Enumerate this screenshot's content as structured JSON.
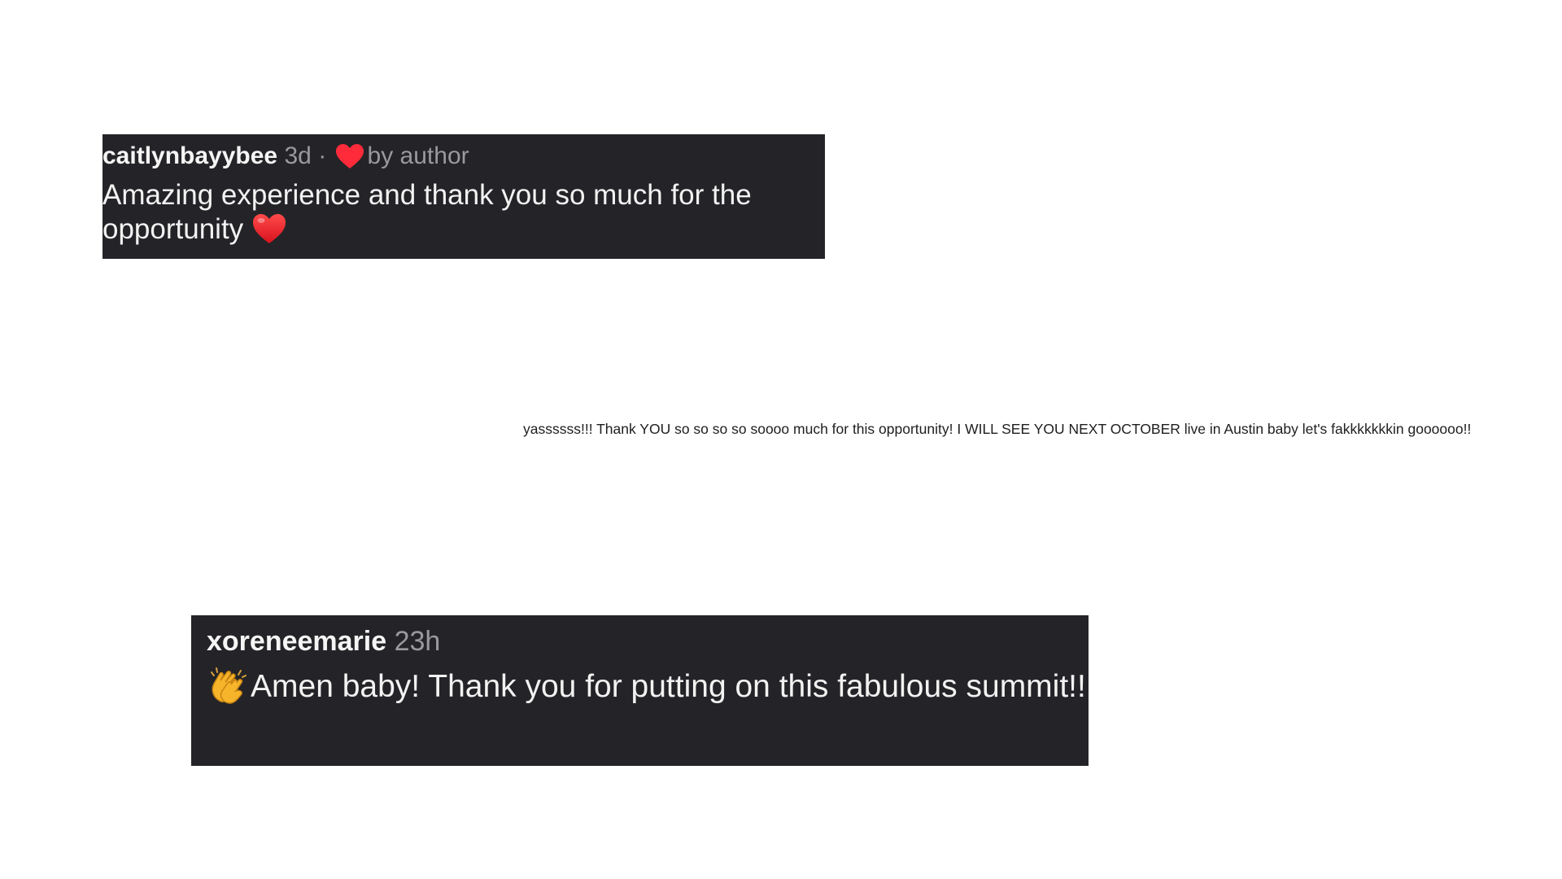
{
  "comments": [
    {
      "username": "caitlynbayybee",
      "time": "3d",
      "separator": "·",
      "liked_label": "by author",
      "liked_icon": "heart-icon",
      "text": "Amazing experience and thank you so much for the opportunity",
      "trailing_emoji": "red-heart-emoji"
    },
    {
      "text": "yassssss!!! Thank YOU so so so so soooo much for this opportunity! I WILL SEE YOU NEXT OCTOBER live in Austin baby let's fakkkkkkkin goooooo!!"
    },
    {
      "username": "xoreneemarie",
      "time": "23h",
      "leading_emoji": "clapping-hands-emoji",
      "text": "Amen baby! Thank you for putting on this fabulous summit!!"
    }
  ],
  "colors": {
    "card_background": "#242428",
    "heart": "#ff2a3a",
    "muted_text": "#9a9a9e"
  }
}
